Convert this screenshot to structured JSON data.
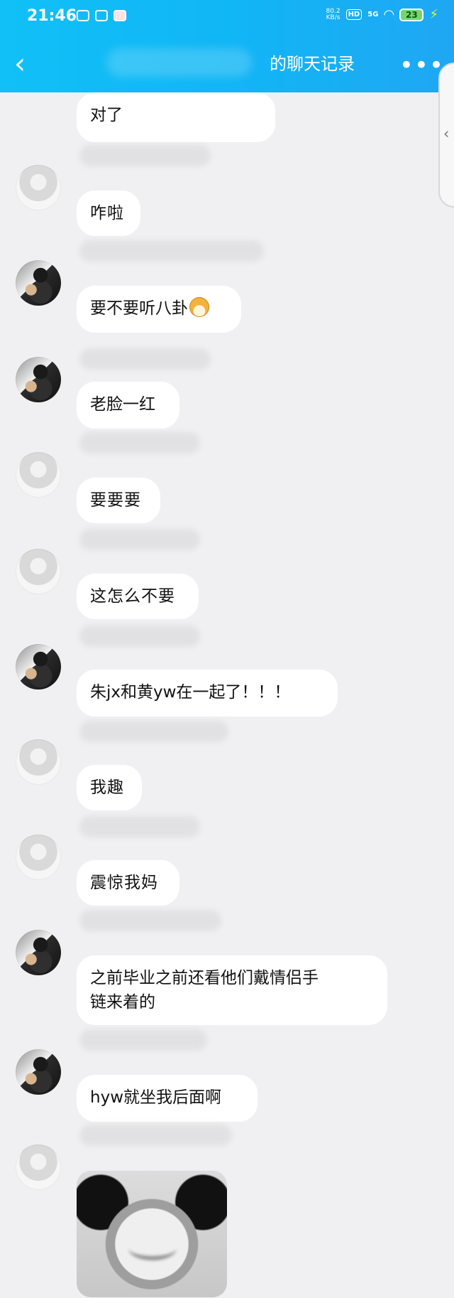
{
  "status_bar": {
    "time": "21:46",
    "speed_value": "80.2",
    "speed_unit": "KB/s",
    "hd": "HD",
    "network": "5G",
    "battery": "23"
  },
  "header": {
    "back_icon": "chevron-left-icon",
    "title": "的聊天记录",
    "more_icon": "more-icon"
  },
  "messages": [
    {
      "sender_avatar": "gray",
      "text": "对了",
      "style": "standard"
    },
    {
      "sender_avatar": "gray",
      "text": "咋啦",
      "style": "script"
    },
    {
      "sender_avatar": "sunglasses",
      "text": "要不要听八卦",
      "style": "standard",
      "emoji_icon": "dog-emoji-icon"
    },
    {
      "sender_avatar": "sunglasses",
      "text": "老脸一红",
      "style": "standard"
    },
    {
      "sender_avatar": "gray",
      "text": "要要要",
      "style": "script"
    },
    {
      "sender_avatar": "gray",
      "text": "这怎么不要",
      "style": "script"
    },
    {
      "sender_avatar": "sunglasses",
      "text": "朱jx和黄yw在一起了！！！",
      "style": "standard"
    },
    {
      "sender_avatar": "gray",
      "text": "我趣",
      "style": "script"
    },
    {
      "sender_avatar": "gray",
      "text": "震惊我妈",
      "style": "script"
    },
    {
      "sender_avatar": "sunglasses",
      "text_line_1": "之前毕业之前还看他们戴情侣手",
      "text_line_2": "链来着的",
      "style": "standard"
    },
    {
      "sender_avatar": "sunglasses",
      "text": "hyw就坐我后面啊",
      "style": "standard"
    },
    {
      "sender_avatar": "gray",
      "image": "panda-meme-image"
    }
  ],
  "icons": {
    "sidebar_chevron": "chevron-left-icon"
  }
}
